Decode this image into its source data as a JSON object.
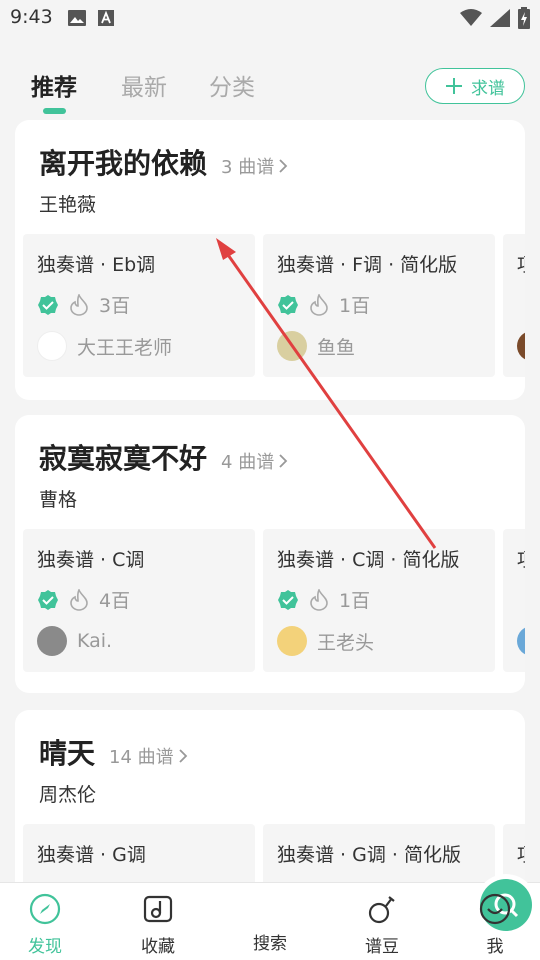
{
  "status_bar": {
    "time": "9:43",
    "left_icons": [
      "image-icon",
      "a-icon"
    ],
    "right_icons": [
      "wifi-icon",
      "signal-icon",
      "battery-icon"
    ]
  },
  "tabs": [
    {
      "label": "推荐",
      "active": true
    },
    {
      "label": "最新",
      "active": false
    },
    {
      "label": "分类",
      "active": false
    }
  ],
  "request_button": {
    "label": "求谱",
    "icon": "plus-icon"
  },
  "accent_color": "#41c39a",
  "songs": [
    {
      "title": "离开我的依赖",
      "count": "3 曲谱",
      "artist": "王艳薇",
      "scores": [
        {
          "name": "独奏谱 · Eb调",
          "verified": true,
          "heat": "3百",
          "author": "大王王老师"
        },
        {
          "name": "独奏谱 · F调 · 简化版",
          "verified": true,
          "heat": "1百",
          "author": "鱼鱼"
        },
        {
          "name": "项"
        }
      ]
    },
    {
      "title": "寂寞寂寞不好",
      "count": "4 曲谱",
      "artist": "曹格",
      "scores": [
        {
          "name": "独奏谱 · C调",
          "verified": true,
          "heat": "4百",
          "author": "Kai."
        },
        {
          "name": "独奏谱 · C调 · 简化版",
          "verified": true,
          "heat": "1百",
          "author": "王老头"
        },
        {
          "name": "项"
        }
      ]
    },
    {
      "title": "晴天",
      "count": "14 曲谱",
      "artist": "周杰伦",
      "scores": [
        {
          "name": "独奏谱 · G调"
        },
        {
          "name": "独奏谱 · G调 · 简化版"
        },
        {
          "name": "项"
        }
      ]
    }
  ],
  "bottom_nav": [
    {
      "label": "发现",
      "icon": "compass-icon",
      "active": true
    },
    {
      "label": "收藏",
      "icon": "music-note-icon",
      "active": false
    },
    {
      "label": "搜索",
      "icon": "search-icon",
      "active": false
    },
    {
      "label": "谱豆",
      "icon": "bean-icon",
      "active": false
    },
    {
      "label": "我",
      "icon": "smiley-icon",
      "active": false
    }
  ]
}
